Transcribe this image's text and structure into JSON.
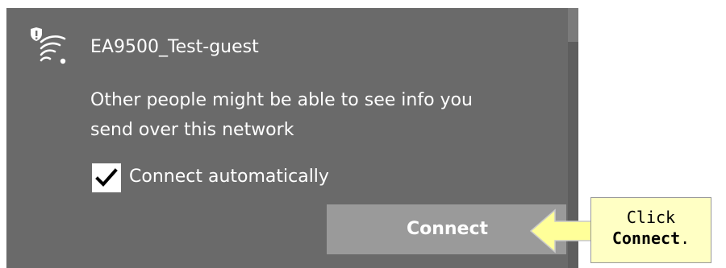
{
  "network": {
    "name": "EA9500_Test-guest",
    "icon": "wifi-unsecured-icon",
    "warning_line1": "Other people might be able to see info you",
    "warning_line2": "send over this network",
    "connect_automatically_label": "Connect automatically",
    "connect_automatically_checked": true,
    "connect_button_label": "Connect"
  },
  "callout": {
    "line1": "Click",
    "bold_word": "Connect",
    "suffix": "."
  },
  "colors": {
    "flyout_bg": "#6a6a6a",
    "button_bg": "#9a9a9a",
    "callout_bg": "#ffffc4",
    "arrow_fill": "#ffff99"
  }
}
